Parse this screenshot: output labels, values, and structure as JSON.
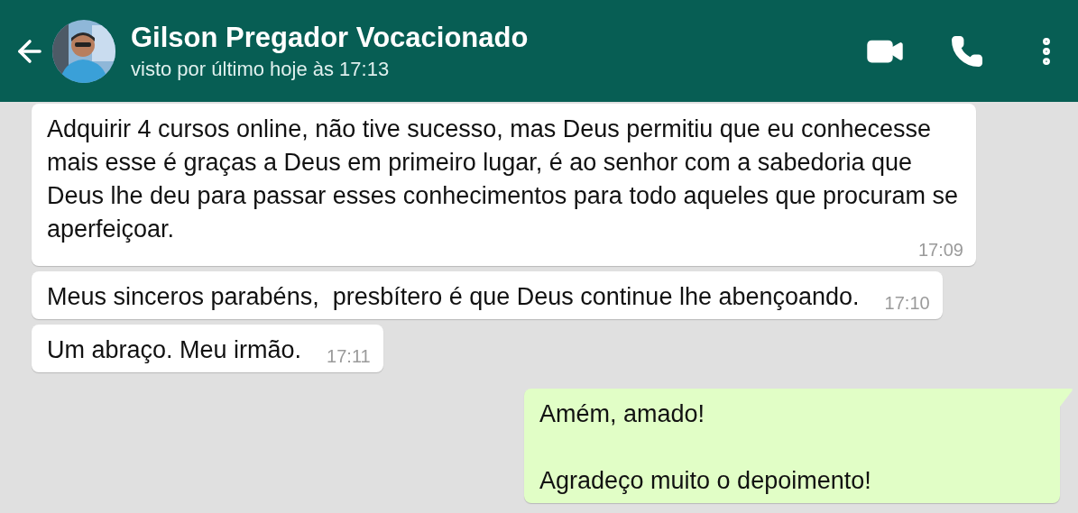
{
  "header": {
    "contact_name": "Gilson Pregador Vocacionado",
    "status": "visto por último hoje às 17:13"
  },
  "messages": [
    {
      "kind": "incoming",
      "text": "Adquirir 4 cursos online, não tive sucesso, mas Deus permitiu que eu conhecesse mais esse é graças a Deus em primeiro lugar, é ao senhor com a sabedoria que Deus lhe deu para passar esses conhecimentos para todo aqueles que procuram se aperfeiçoar.",
      "time": "17:09"
    },
    {
      "kind": "incoming",
      "text": "Meus sinceros parabéns,  presbítero é que Deus continue lhe abençoando.",
      "time": "17:10"
    },
    {
      "kind": "incoming",
      "text": "Um abraço. Meu irmão.",
      "time": "17:11"
    },
    {
      "kind": "outgoing",
      "text": "Amém, amado!\n\nAgradeço muito o depoimento!"
    }
  ]
}
